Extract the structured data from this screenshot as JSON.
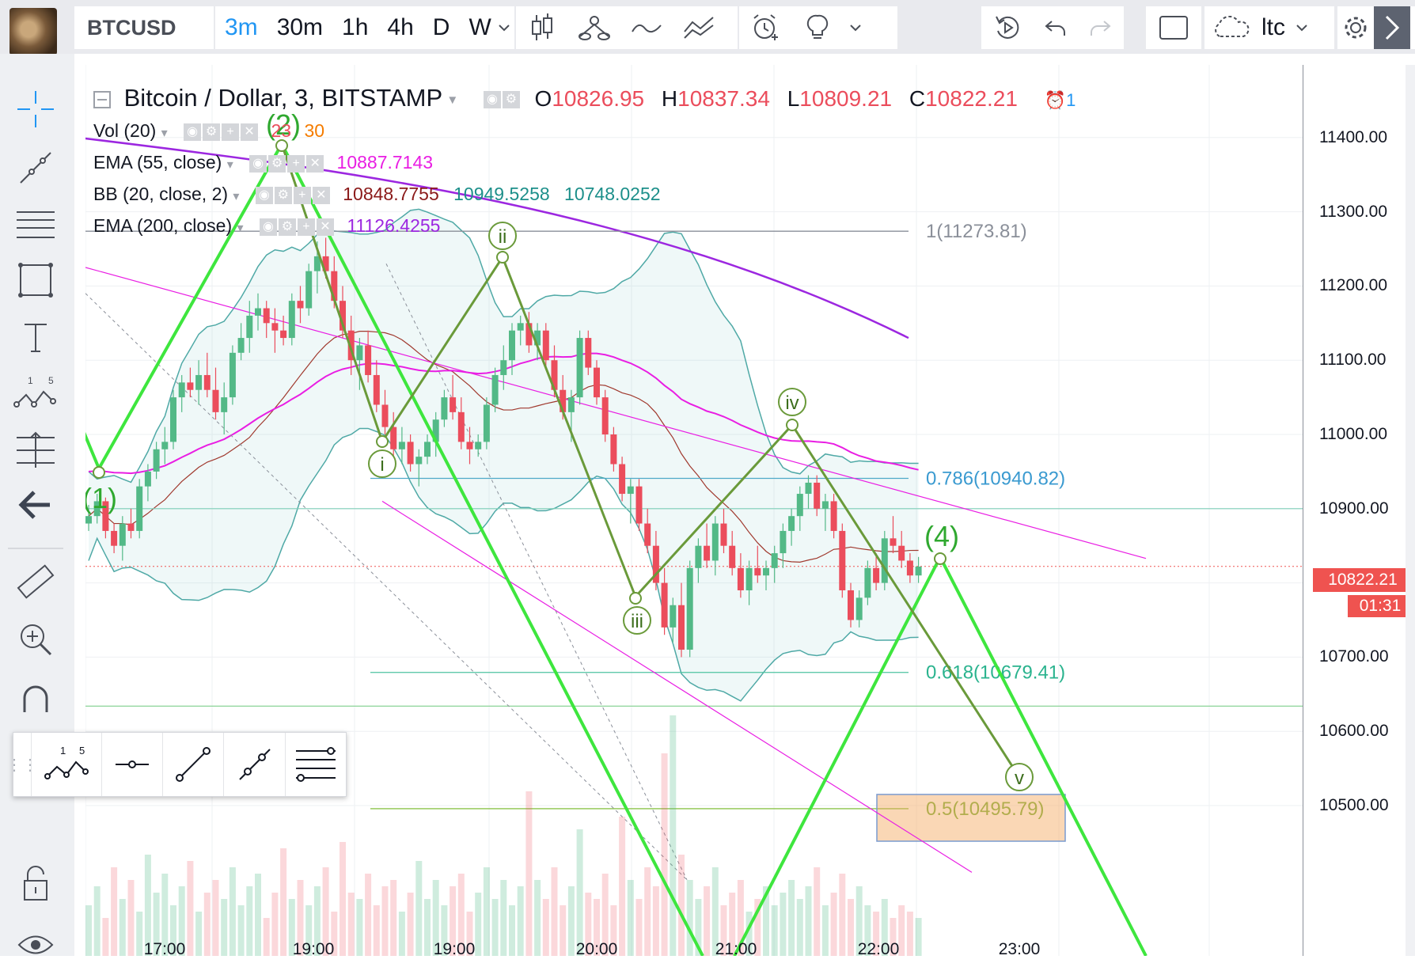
{
  "toolbar": {
    "symbol": "BTCUSD",
    "intervals": [
      "3m",
      "30m",
      "1h",
      "4h",
      "D",
      "W"
    ],
    "active_interval": "3m",
    "layout_name": "ltc"
  },
  "legend": {
    "title": "Bitcoin / Dollar, 3, BITSTAMP",
    "o_label": "O",
    "o": "10826.95",
    "h_label": "H",
    "h": "10837.34",
    "l_label": "L",
    "l": "10809.21",
    "c_label": "C",
    "c": "10822.21",
    "alerts": "1",
    "vol_name": "Vol (20)",
    "vol_val1": "23",
    "vol_val2": "30",
    "ema55_name": "EMA (55, close)",
    "ema55_val": "10887.7143",
    "bb_name": "BB (20, close, 2)",
    "bb_mid": "10848.7755",
    "bb_up": "10949.5258",
    "bb_low": "10748.0252",
    "ema200_name": "EMA (200, close)",
    "ema200_val": "11126.4255"
  },
  "colors": {
    "up": "#53b987",
    "down": "#eb4d5c",
    "wave": "#4caf50",
    "ema55": "#e91ee3",
    "ema200": "#9c27e0",
    "accent": "#2196f3"
  },
  "price_scale": {
    "labels": [
      "11400.00",
      "11300.00",
      "11200.00",
      "11100.00",
      "11000.00",
      "10900.00",
      "10800.00",
      "10700.00",
      "10600.00",
      "10500.00"
    ],
    "current_price": "10822.21",
    "countdown": "01:31"
  },
  "time_labels": [
    "17:00",
    "19:00",
    "19:00",
    "20:00",
    "21:00",
    "22:00",
    "23:00"
  ],
  "fib": {
    "level_1": "1(11273.81)",
    "level_786": "0.786(10940.82)",
    "level_618": "0.618(10679.41)",
    "level_5": "0.5(10495.79)"
  },
  "waves": {
    "w1": "(1)",
    "w2": "(2)",
    "w4": "(4)",
    "i": "i",
    "ii": "ii",
    "iii": "iii",
    "iv": "iv",
    "v": "v"
  },
  "float_toolbar": {
    "elliott_label_a": "1",
    "elliott_label_b": "5"
  },
  "left_toolbar": {
    "elliott_a": "1",
    "elliott_b": "5"
  },
  "chart_data": {
    "type": "candlestick",
    "price_range": [
      10400,
      11430
    ],
    "candles": [
      [
        10880,
        10905,
        10870,
        10890
      ],
      [
        10890,
        10920,
        10880,
        10910
      ],
      [
        10910,
        10915,
        10860,
        10870
      ],
      [
        10870,
        10880,
        10840,
        10850
      ],
      [
        10850,
        10890,
        10830,
        10880
      ],
      [
        10880,
        10900,
        10860,
        10870
      ],
      [
        10870,
        10940,
        10860,
        10930
      ],
      [
        10930,
        10960,
        10910,
        10950
      ],
      [
        10950,
        10990,
        10940,
        10980
      ],
      [
        10980,
        11010,
        10960,
        10990
      ],
      [
        10990,
        11060,
        10980,
        11050
      ],
      [
        11050,
        11080,
        11030,
        11070
      ],
      [
        11070,
        11090,
        11050,
        11060
      ],
      [
        11060,
        11100,
        11040,
        11080
      ],
      [
        11080,
        11110,
        11050,
        11060
      ],
      [
        11060,
        11090,
        11020,
        11030
      ],
      [
        11030,
        11070,
        11000,
        11050
      ],
      [
        11050,
        11120,
        11040,
        11110
      ],
      [
        11110,
        11150,
        11100,
        11130
      ],
      [
        11130,
        11180,
        11110,
        11160
      ],
      [
        11160,
        11190,
        11140,
        11170
      ],
      [
        11170,
        11180,
        11130,
        11150
      ],
      [
        11150,
        11170,
        11110,
        11140
      ],
      [
        11140,
        11160,
        11120,
        11130
      ],
      [
        11130,
        11190,
        11120,
        11180
      ],
      [
        11180,
        11200,
        11150,
        11170
      ],
      [
        11170,
        11230,
        11160,
        11220
      ],
      [
        11220,
        11260,
        11190,
        11240
      ],
      [
        11240,
        11265,
        11210,
        11220
      ],
      [
        11220,
        11240,
        11170,
        11180
      ],
      [
        11180,
        11200,
        11130,
        11140
      ],
      [
        11140,
        11160,
        11080,
        11100
      ],
      [
        11100,
        11130,
        11060,
        11120
      ],
      [
        11120,
        11140,
        11070,
        11080
      ],
      [
        11080,
        11100,
        11030,
        11040
      ],
      [
        11040,
        11060,
        11000,
        11010
      ],
      [
        11010,
        11030,
        10970,
        10980
      ],
      [
        10980,
        11010,
        10960,
        10990
      ],
      [
        10990,
        11000,
        10950,
        10960
      ],
      [
        10960,
        10980,
        10930,
        10970
      ],
      [
        10970,
        11000,
        10960,
        10990
      ],
      [
        10990,
        11030,
        10970,
        11020
      ],
      [
        11020,
        11060,
        11010,
        11050
      ],
      [
        11050,
        11080,
        11020,
        11030
      ],
      [
        11030,
        11050,
        10980,
        10990
      ],
      [
        10990,
        11010,
        10960,
        10980
      ],
      [
        10980,
        11000,
        10970,
        10990
      ],
      [
        10990,
        11050,
        10980,
        11040
      ],
      [
        11040,
        11090,
        11030,
        11080
      ],
      [
        11080,
        11120,
        11060,
        11100
      ],
      [
        11100,
        11150,
        11080,
        11140
      ],
      [
        11140,
        11160,
        11120,
        11150
      ],
      [
        11150,
        11165,
        11110,
        11120
      ],
      [
        11120,
        11150,
        11100,
        11140
      ],
      [
        11140,
        11150,
        11090,
        11100
      ],
      [
        11100,
        11120,
        11050,
        11060
      ],
      [
        11060,
        11080,
        11020,
        11030
      ],
      [
        11030,
        11060,
        10990,
        11050
      ],
      [
        11050,
        11140,
        11040,
        11130
      ],
      [
        11130,
        11140,
        11080,
        11090
      ],
      [
        11090,
        11100,
        11040,
        11050
      ],
      [
        11050,
        11060,
        10990,
        11000
      ],
      [
        11000,
        11010,
        10950,
        10960
      ],
      [
        10960,
        10970,
        10910,
        10920
      ],
      [
        10920,
        10940,
        10880,
        10930
      ],
      [
        10930,
        10940,
        10870,
        10880
      ],
      [
        10880,
        10900,
        10840,
        10850
      ],
      [
        10850,
        10870,
        10790,
        10800
      ],
      [
        10800,
        10820,
        10730,
        10740
      ],
      [
        10740,
        10780,
        10720,
        10770
      ],
      [
        10770,
        10800,
        10700,
        10710
      ],
      [
        10710,
        10830,
        10700,
        10820
      ],
      [
        10820,
        10860,
        10800,
        10850
      ],
      [
        10850,
        10880,
        10820,
        10830
      ],
      [
        10830,
        10890,
        10810,
        10880
      ],
      [
        10880,
        10900,
        10840,
        10850
      ],
      [
        10850,
        10870,
        10810,
        10820
      ],
      [
        10820,
        10840,
        10780,
        10790
      ],
      [
        10790,
        10830,
        10770,
        10820
      ],
      [
        10820,
        10850,
        10800,
        10810
      ],
      [
        10810,
        10830,
        10790,
        10820
      ],
      [
        10820,
        10850,
        10800,
        10840
      ],
      [
        10840,
        10880,
        10820,
        10870
      ],
      [
        10870,
        10900,
        10850,
        10890
      ],
      [
        10890,
        10930,
        10870,
        10920
      ],
      [
        10920,
        10945,
        10900,
        10935
      ],
      [
        10935,
        10945,
        10890,
        10900
      ],
      [
        10900,
        10920,
        10870,
        10910
      ],
      [
        10910,
        10920,
        10860,
        10870
      ],
      [
        10870,
        10880,
        10780,
        10790
      ],
      [
        10790,
        10800,
        10740,
        10750
      ],
      [
        10750,
        10790,
        10740,
        10780
      ],
      [
        10780,
        10830,
        10770,
        10820
      ],
      [
        10820,
        10840,
        10790,
        10800
      ],
      [
        10800,
        10870,
        10790,
        10860
      ],
      [
        10860,
        10890,
        10840,
        10850
      ],
      [
        10850,
        10870,
        10820,
        10830
      ],
      [
        10830,
        10840,
        10800,
        10810
      ],
      [
        10810,
        10835,
        10800,
        10822
      ]
    ]
  }
}
